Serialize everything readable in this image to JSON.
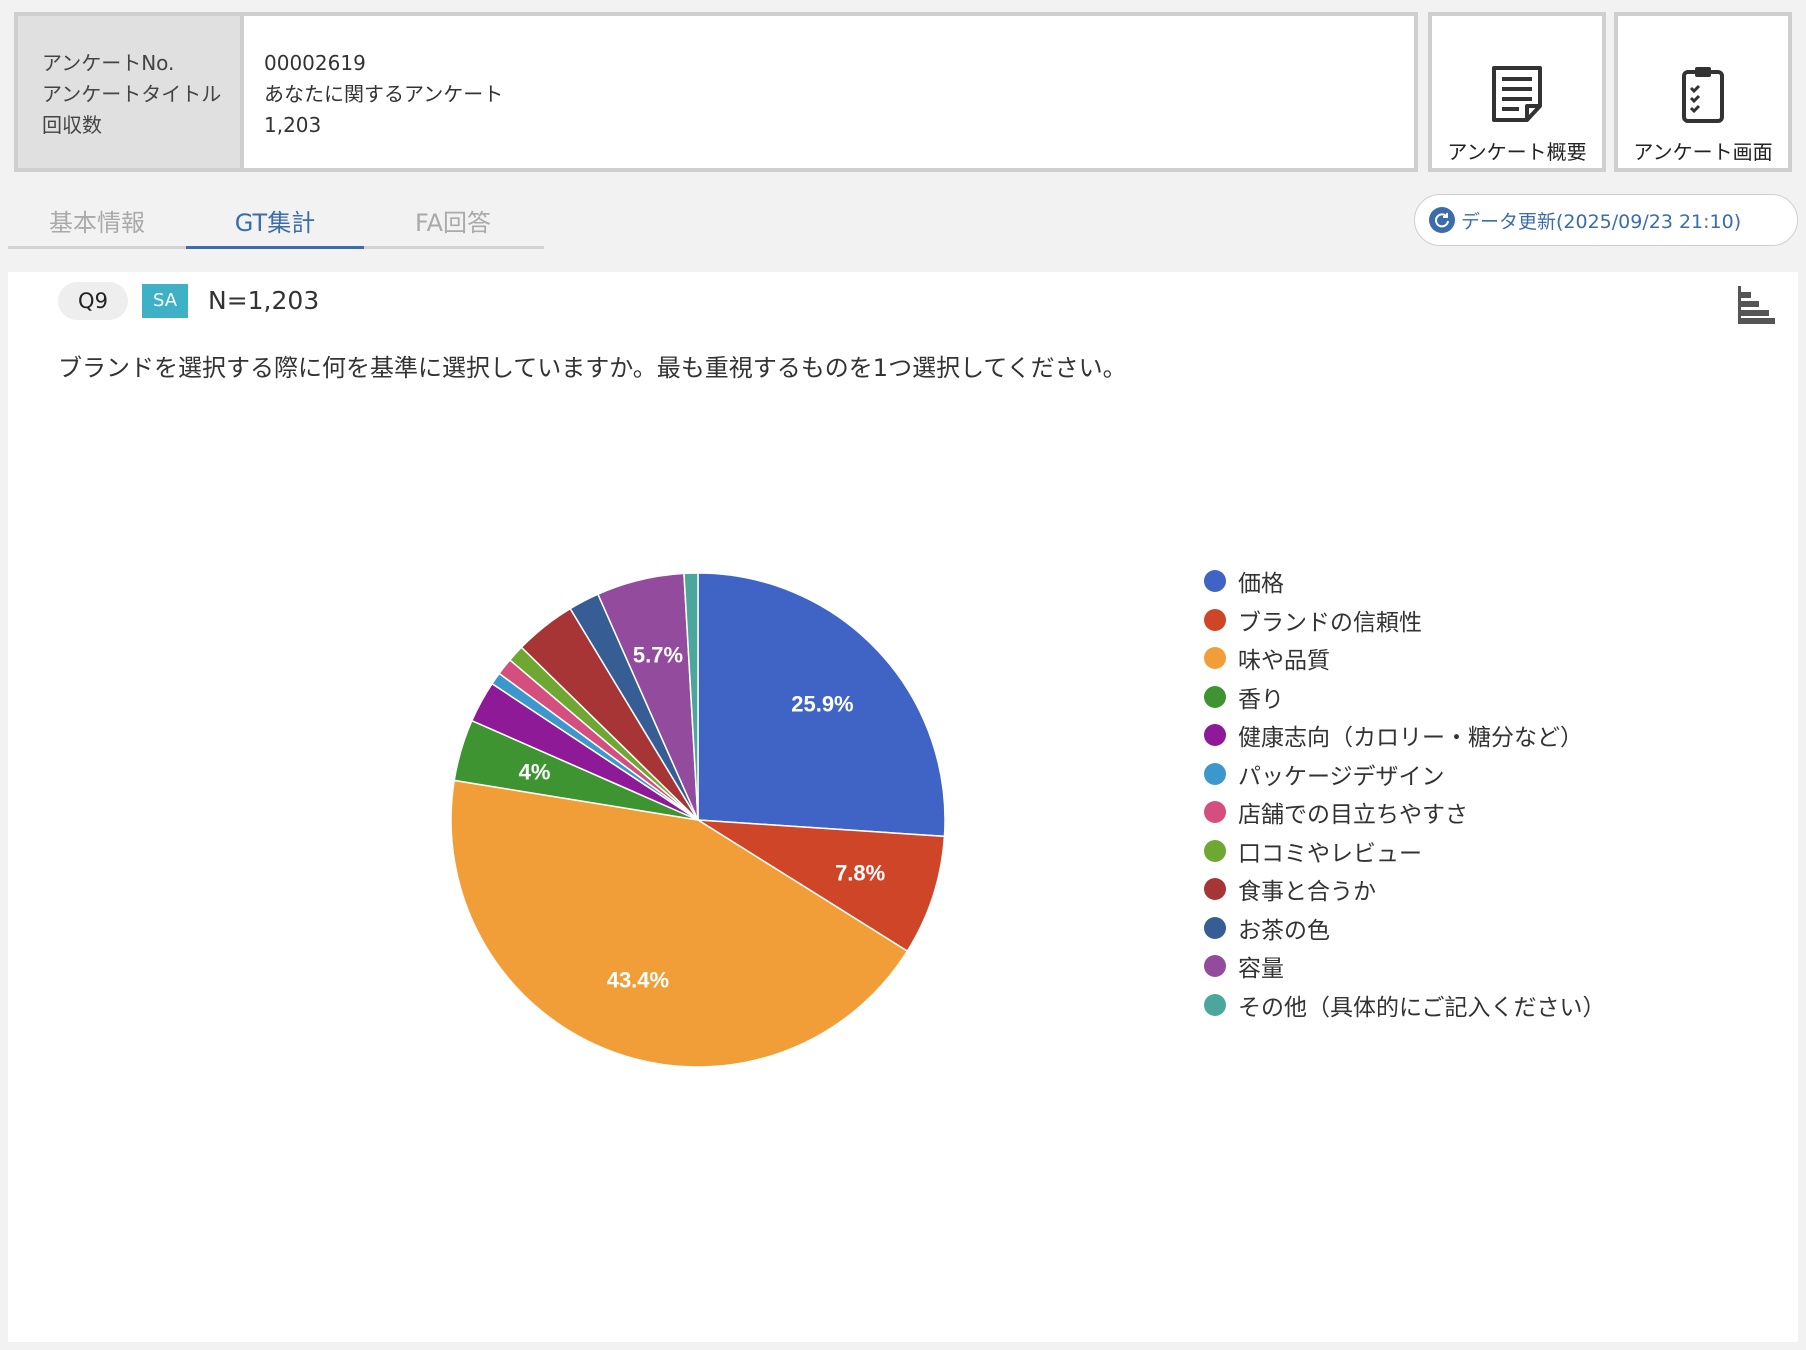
{
  "header": {
    "labels": [
      "アンケートNo.",
      "アンケートタイトル",
      "回収数"
    ],
    "survey_no": "00002619",
    "survey_title": "あなたに関するアンケート",
    "responses": "1,203",
    "overview_button": "アンケート概要",
    "screen_button": "アンケート画面"
  },
  "tabs": [
    "基本情報",
    "GT集計",
    "FA回答"
  ],
  "active_tab": "GT集計",
  "refresh": {
    "label": "データ更新(2025/09/23 21:10)",
    "icon": "refresh-icon"
  },
  "question": {
    "id": "Q9",
    "type_badge": "SA",
    "n": "N=1,203",
    "text": "ブランドを選択する際に何を基準に選択していますか。最も重視するものを1つ選択してください。"
  },
  "chart_data": {
    "type": "pie",
    "unit": "%",
    "slices": [
      {
        "label": "価格",
        "value": 25.9,
        "color": "#4064c6",
        "data_label": "25.9%"
      },
      {
        "label": "ブランドの信頼性",
        "value": 7.8,
        "color": "#cf4527",
        "data_label": "7.8%"
      },
      {
        "label": "味や品質",
        "value": 43.4,
        "color": "#f29e38",
        "data_label": "43.4%"
      },
      {
        "label": "香り",
        "value": 4.0,
        "color": "#3f9432",
        "data_label": "4%"
      },
      {
        "label": "健康志向（カロリー・糖分など）",
        "value": 2.7,
        "color": "#8e1a98",
        "data_label": ""
      },
      {
        "label": "パッケージデザイン",
        "value": 0.8,
        "color": "#3c98cc",
        "data_label": ""
      },
      {
        "label": "店舗での目立ちやすさ",
        "value": 1.1,
        "color": "#d44f7f",
        "data_label": ""
      },
      {
        "label": "口コミやレビュー",
        "value": 1.1,
        "color": "#6ea731",
        "data_label": ""
      },
      {
        "label": "食事と合うか",
        "value": 4.0,
        "color": "#a83535",
        "data_label": ""
      },
      {
        "label": "お茶の色",
        "value": 2.0,
        "color": "#375e94",
        "data_label": ""
      },
      {
        "label": "容量",
        "value": 5.7,
        "color": "#924b9d",
        "data_label": "5.7%"
      },
      {
        "label": "その他（具体的にご記入ください）",
        "value": 0.9,
        "color": "#4ba79c",
        "data_label": ""
      }
    ],
    "legend_position": "right"
  }
}
